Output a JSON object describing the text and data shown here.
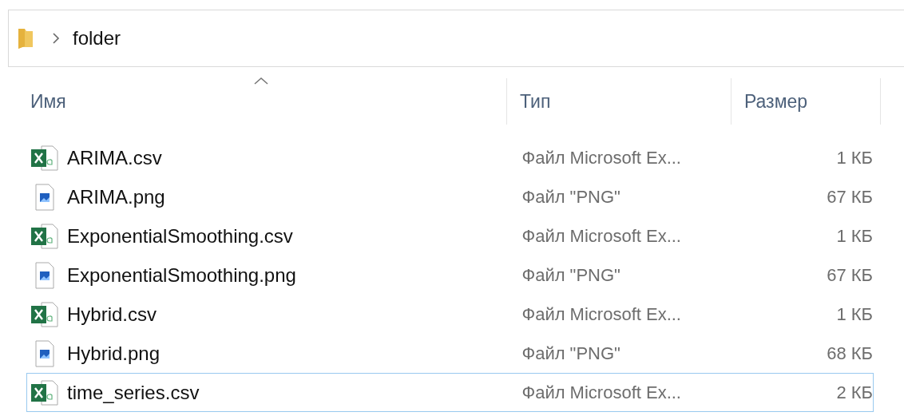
{
  "address_bar": {
    "path": [
      "folder"
    ]
  },
  "columns": [
    {
      "label": "Имя",
      "sorted": true
    },
    {
      "label": "Тип",
      "sorted": false
    },
    {
      "label": "Размер",
      "sorted": false
    }
  ],
  "files": [
    {
      "name": "ARIMA.csv",
      "kind": "csv",
      "type": "Файл Microsoft Ex...",
      "size": "1 КБ",
      "focused": false
    },
    {
      "name": "ARIMA.png",
      "kind": "png",
      "type": "Файл \"PNG\"",
      "size": "67 КБ",
      "focused": false
    },
    {
      "name": "ExponentialSmoothing.csv",
      "kind": "csv",
      "type": "Файл Microsoft Ex...",
      "size": "1 КБ",
      "focused": false
    },
    {
      "name": "ExponentialSmoothing.png",
      "kind": "png",
      "type": "Файл \"PNG\"",
      "size": "67 КБ",
      "focused": false
    },
    {
      "name": "Hybrid.csv",
      "kind": "csv",
      "type": "Файл Microsoft Ex...",
      "size": "1 КБ",
      "focused": false
    },
    {
      "name": "Hybrid.png",
      "kind": "png",
      "type": "Файл \"PNG\"",
      "size": "68 КБ",
      "focused": false
    },
    {
      "name": "time_series.csv",
      "kind": "csv",
      "type": "Файл Microsoft Ex...",
      "size": "2 КБ",
      "focused": true
    }
  ]
}
